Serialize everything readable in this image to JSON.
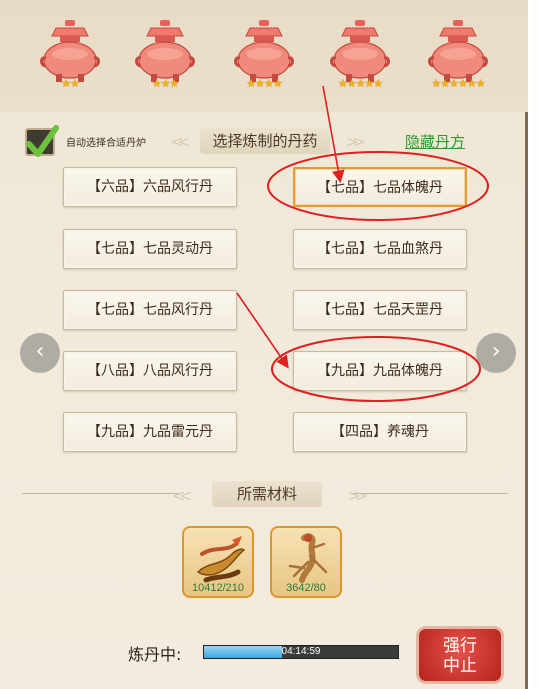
{
  "furnaces": [
    {
      "name": "furnace-1",
      "stars": 2
    },
    {
      "name": "furnace-2",
      "stars": 3
    },
    {
      "name": "furnace-3",
      "stars": 4
    },
    {
      "name": "furnace-4",
      "stars": 5
    },
    {
      "name": "furnace-5",
      "stars": 6
    }
  ],
  "header": {
    "auto_select_label": "自动选择合适丹炉",
    "auto_select_checked": true,
    "title": "选择炼制的丹药",
    "hidden_recipe_link": "隐藏丹方"
  },
  "recipes": [
    {
      "label": "【六品】六品风行丹",
      "selected": false
    },
    {
      "label": "【七品】七品体魄丹",
      "selected": true
    },
    {
      "label": "【七品】七品灵动丹",
      "selected": false
    },
    {
      "label": "【七品】七品血煞丹",
      "selected": false
    },
    {
      "label": "【七品】七品风行丹",
      "selected": false
    },
    {
      "label": "【七品】七品天罡丹",
      "selected": false
    },
    {
      "label": "【八品】八品风行丹",
      "selected": false
    },
    {
      "label": "【九品】九品体魄丹",
      "selected": false
    },
    {
      "label": "【九品】九品雷元丹",
      "selected": false
    },
    {
      "label": "【四品】养魂丹",
      "selected": false
    }
  ],
  "nav": {
    "prev_icon": "chevron-left-icon",
    "next_icon": "chevron-right-icon",
    "prev_glyph": "‹",
    "next_glyph": "›"
  },
  "materials": {
    "title": "所需材料",
    "items": [
      {
        "icon": "herb-root-icon",
        "count": "10412/210"
      },
      {
        "icon": "ginseng-icon",
        "count": "3642/80"
      }
    ]
  },
  "progress": {
    "label": "炼丹中:",
    "time": "04:14:59",
    "fraction": 0.4
  },
  "force_stop": {
    "line1": "强行",
    "line2": "中止"
  },
  "colors": {
    "accent_green": "#2e9a2a",
    "selected_border": "#e39a3a",
    "annotation_red": "#e02020",
    "progress_fill": "#41a7df"
  }
}
